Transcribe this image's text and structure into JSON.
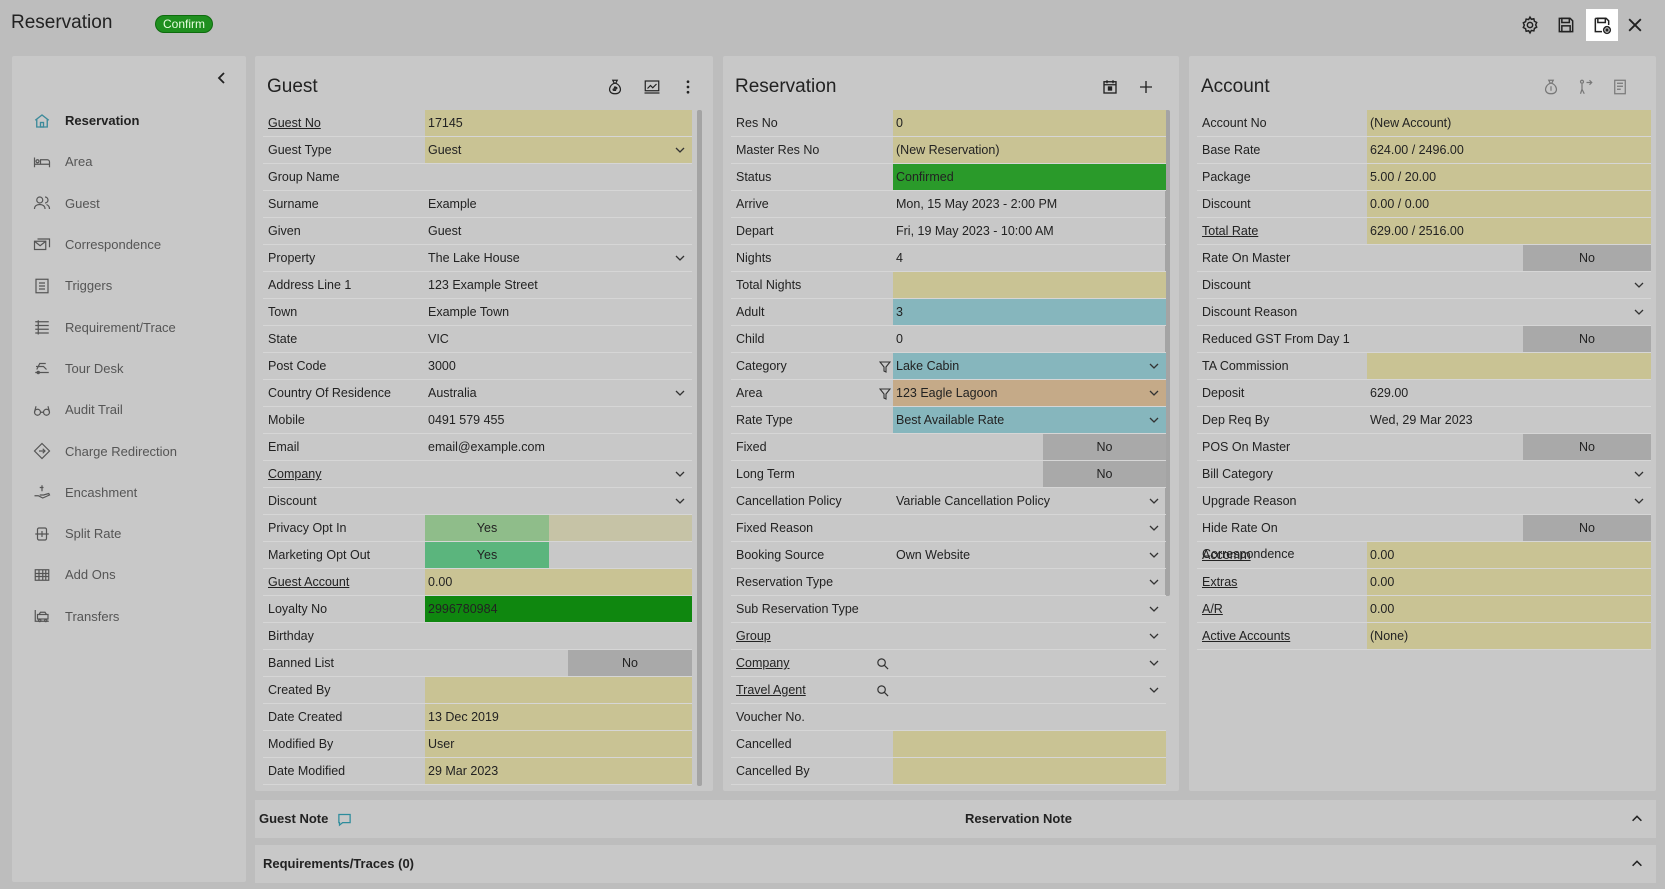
{
  "header": {
    "title": "Reservation",
    "badge": "Confirm",
    "colors": {
      "badge": "#1f8f1f"
    }
  },
  "sidebar": {
    "items": [
      {
        "label": "Reservation",
        "icon": "home-icon"
      },
      {
        "label": "Area",
        "icon": "bed-icon"
      },
      {
        "label": "Guest",
        "icon": "users-icon"
      },
      {
        "label": "Correspondence",
        "icon": "mail-icon"
      },
      {
        "label": "Triggers",
        "icon": "list-icon"
      },
      {
        "label": "Requirement/Trace",
        "icon": "checklist-icon"
      },
      {
        "label": "Tour Desk",
        "icon": "bus-icon"
      },
      {
        "label": "Audit Trail",
        "icon": "glasses-icon"
      },
      {
        "label": "Charge Redirection",
        "icon": "diamond-icon"
      },
      {
        "label": "Encashment",
        "icon": "hand-icon"
      },
      {
        "label": "Split Rate",
        "icon": "split-icon"
      },
      {
        "label": "Add Ons",
        "icon": "grid-icon"
      },
      {
        "label": "Transfers",
        "icon": "car-icon"
      }
    ]
  },
  "guest": {
    "title": "Guest",
    "rows": [
      {
        "label": "Guest No",
        "value": "17145"
      },
      {
        "label": "Guest Type",
        "value": "Guest"
      },
      {
        "label": "Group Name",
        "value": ""
      },
      {
        "label": "Surname",
        "value": "Example"
      },
      {
        "label": "Given",
        "value": "Guest"
      },
      {
        "label": "Property",
        "value": "The Lake House"
      },
      {
        "label": "Address Line 1",
        "value": "123 Example Street"
      },
      {
        "label": "Town",
        "value": "Example Town"
      },
      {
        "label": "State",
        "value": "VIC"
      },
      {
        "label": "Post Code",
        "value": "3000"
      },
      {
        "label": "Country Of Residence",
        "value": "Australia"
      },
      {
        "label": "Mobile",
        "value": "0491 579 455"
      },
      {
        "label": "Email",
        "value": "email@example.com"
      },
      {
        "label": "Company",
        "value": ""
      },
      {
        "label": "Discount",
        "value": ""
      },
      {
        "label": "Privacy Opt In",
        "value": "Yes"
      },
      {
        "label": "Marketing Opt Out",
        "value": "Yes"
      },
      {
        "label": "Guest Account",
        "value": "0.00"
      },
      {
        "label": "Loyalty No",
        "value": "2996780984"
      },
      {
        "label": "Birthday",
        "value": ""
      },
      {
        "label": "Banned List",
        "value": "No"
      },
      {
        "label": "Created By",
        "value": ""
      },
      {
        "label": "Date Created",
        "value": "13 Dec 2019"
      },
      {
        "label": "Modified By",
        "value": "User"
      },
      {
        "label": "Date Modified",
        "value": "29 Mar 2023"
      }
    ]
  },
  "reservation": {
    "title": "Reservation",
    "rows": [
      {
        "label": "Res No",
        "value": "0"
      },
      {
        "label": "Master Res No",
        "value": "(New Reservation)"
      },
      {
        "label": "Status",
        "value": "Confirmed"
      },
      {
        "label": "Arrive",
        "value": "Mon, 15 May 2023 - 2:00 PM"
      },
      {
        "label": "Depart",
        "value": "Fri, 19 May 2023 - 10:00 AM"
      },
      {
        "label": "Nights",
        "value": "4"
      },
      {
        "label": "Total Nights",
        "value": ""
      },
      {
        "label": "Adult",
        "value": "3"
      },
      {
        "label": "Child",
        "value": "0"
      },
      {
        "label": "Category",
        "value": "Lake Cabin"
      },
      {
        "label": "Area",
        "value": "123 Eagle Lagoon"
      },
      {
        "label": "Rate Type",
        "value": "Best Available Rate"
      },
      {
        "label": "Fixed",
        "value": "No"
      },
      {
        "label": "Long Term",
        "value": "No"
      },
      {
        "label": "Cancellation Policy",
        "value": "Variable Cancellation Policy"
      },
      {
        "label": "Fixed Reason",
        "value": ""
      },
      {
        "label": "Booking Source",
        "value": "Own Website"
      },
      {
        "label": "Reservation Type",
        "value": ""
      },
      {
        "label": "Sub Reservation Type",
        "value": ""
      },
      {
        "label": "Group",
        "value": ""
      },
      {
        "label": "Company",
        "value": ""
      },
      {
        "label": "Travel Agent",
        "value": ""
      },
      {
        "label": "Voucher No.",
        "value": ""
      },
      {
        "label": "Cancelled",
        "value": ""
      },
      {
        "label": "Cancelled By",
        "value": ""
      }
    ]
  },
  "account": {
    "title": "Account",
    "rows": [
      {
        "label": "Account No",
        "value": "(New Account)"
      },
      {
        "label": "Base Rate",
        "value": "624.00 / 2496.00"
      },
      {
        "label": "Package",
        "value": "5.00 / 20.00"
      },
      {
        "label": "Discount",
        "value": "0.00 / 0.00"
      },
      {
        "label": "Total Rate",
        "value": "629.00 / 2516.00"
      },
      {
        "label": "Rate On Master",
        "value": "No"
      },
      {
        "label": "Discount",
        "value": ""
      },
      {
        "label": "Discount Reason",
        "value": ""
      },
      {
        "label": "Reduced GST From Day 1",
        "value": "No"
      },
      {
        "label": "TA Commission",
        "value": ""
      },
      {
        "label": "Deposit",
        "value": "629.00"
      },
      {
        "label": "Dep Req By",
        "value": "Wed, 29 Mar 2023"
      },
      {
        "label": "POS On Master",
        "value": "No"
      },
      {
        "label": "Bill Category",
        "value": ""
      },
      {
        "label": "Upgrade Reason",
        "value": ""
      },
      {
        "label": "Hide Rate On Correspondence",
        "value": "No"
      },
      {
        "label": "Accomm",
        "value": "0.00"
      },
      {
        "label": "Extras",
        "value": "0.00"
      },
      {
        "label": "A/R",
        "value": "0.00"
      },
      {
        "label": "Active Accounts",
        "value": "(None)"
      }
    ]
  },
  "notes": {
    "guest_note": "Guest Note",
    "reservation_note": "Reservation Note",
    "requirements": "Requirements/Traces (0)"
  }
}
